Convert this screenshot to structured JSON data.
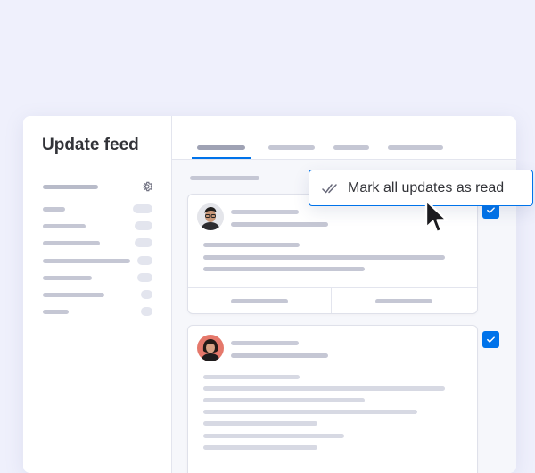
{
  "colors": {
    "background": "#eff0fc",
    "accent": "#0073ea",
    "text": "#323338",
    "placeholder_bar": "#c5c7d4"
  },
  "sidebar": {
    "title": "Update feed",
    "settings_icon": "gear-icon"
  },
  "tooltip": {
    "icon": "double-check-icon",
    "label": "Mark all updates as read"
  },
  "cursor": {
    "icon": "arrow-pointer-icon"
  },
  "feed": {
    "cards": [
      {
        "checked": true,
        "avatar": "avatar-man-glasses"
      },
      {
        "checked": true,
        "avatar": "avatar-woman"
      }
    ]
  }
}
